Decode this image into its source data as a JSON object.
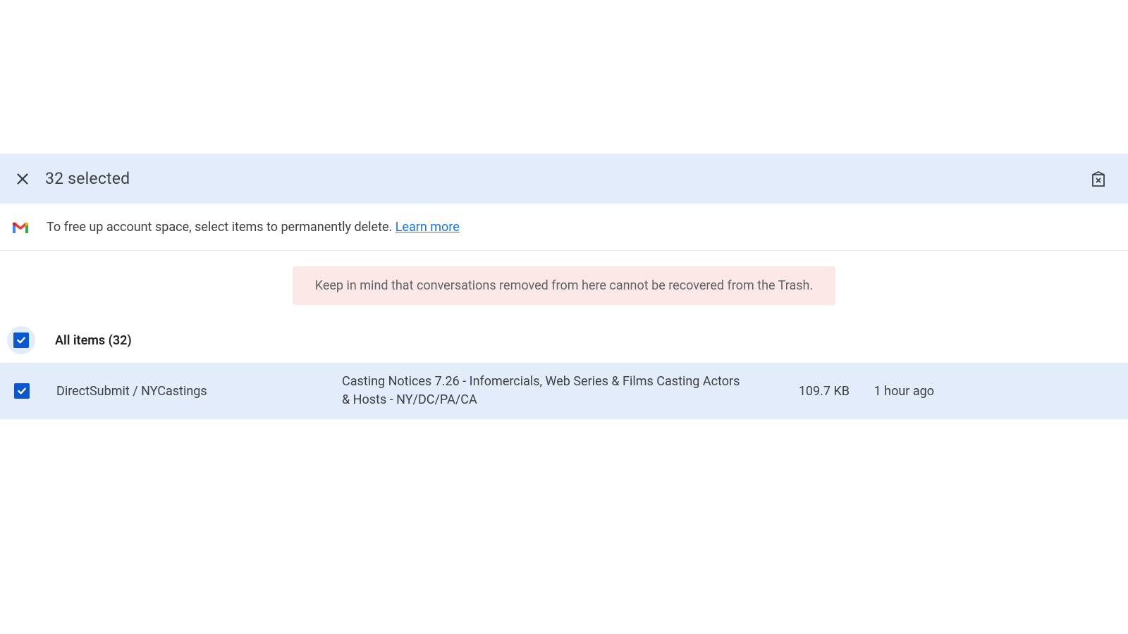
{
  "selectionBar": {
    "countText": "32 selected"
  },
  "infoBar": {
    "text": "To free up account space, select items to permanently delete. ",
    "linkText": "Learn more"
  },
  "warning": {
    "text": "Keep in mind that conversations removed from here cannot be recovered from the Trash."
  },
  "allItems": {
    "label": "All items (32)"
  },
  "rows": [
    {
      "sender": "DirectSubmit / NYCastings",
      "subject": "Casting Notices 7.26 - Infomercials, Web Series & Films Casting Actors & Hosts - NY/DC/PA/CA",
      "size": "109.7 KB",
      "time": "1 hour ago"
    }
  ]
}
